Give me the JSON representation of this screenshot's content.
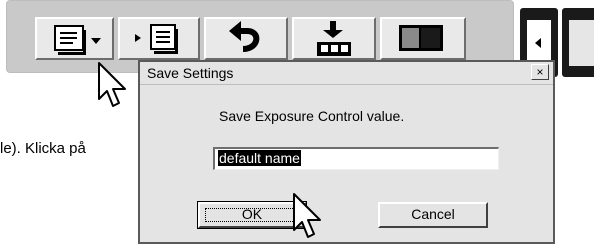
{
  "document": {
    "partial_text": "le). Klicka på"
  },
  "toolbar": {
    "buttons": [
      {
        "icon": "document-list-dropdown-icon"
      },
      {
        "icon": "play-document-icon"
      },
      {
        "icon": "undo-arrow-icon"
      },
      {
        "icon": "import-arrow-icon"
      },
      {
        "icon": "split-view-icon"
      }
    ]
  },
  "dialog": {
    "title": "Save Settings",
    "close_label": "×",
    "message": "Save Exposure Control value.",
    "input_value": "default name",
    "ok_label": "OK",
    "cancel_label": "Cancel"
  },
  "colors": {
    "dialog_bg": "#e4e4e4",
    "toolbar_bg": "#c9c9c9",
    "selection": "#000000"
  }
}
